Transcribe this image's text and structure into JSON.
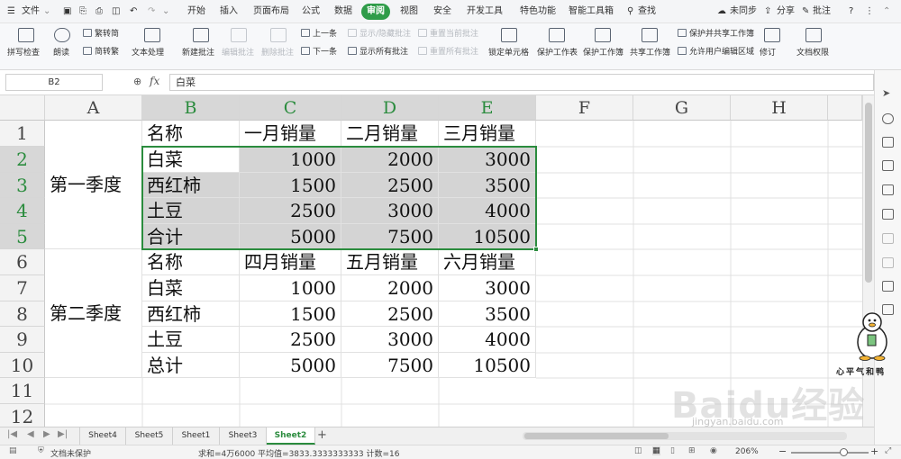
{
  "menubar": {
    "file": "文件",
    "menus": [
      "开始",
      "插入",
      "页面布局",
      "公式",
      "数据",
      "审阅",
      "视图",
      "安全",
      "开发工具",
      "特色功能",
      "智能工具箱"
    ],
    "search": "查找",
    "sync": "未同步",
    "share": "分享",
    "comment": "批注",
    "help": "?"
  },
  "ribbon": {
    "spell_check": "拼写检查",
    "read_aloud": "朗读",
    "trad_to_simp": "繁转简",
    "simp_to_trad": "简转繁",
    "text_process": "文本处理",
    "new_comment": "新建批注",
    "edit_comment": "编辑批注",
    "delete_comment": "删除批注",
    "prev": "上一条",
    "next": "下一条",
    "show_hide_comment": "显示/隐藏批注",
    "show_all_comments": "显示所有批注",
    "reset_current_comment": "重置当前批注",
    "reset_all_comments": "重置所有批注",
    "lock_cell": "锁定单元格",
    "protect_sheet": "保护工作表",
    "protect_workbook": "保护工作簿",
    "share_workbook": "共享工作簿",
    "protect_share_workbook": "保护并共享工作簿",
    "allow_edit_range": "允许用户编辑区域",
    "revise": "修订",
    "doc_permission": "文档权限"
  },
  "formula_bar": {
    "name_box": "B2",
    "fx": "fx",
    "content": "白菜"
  },
  "columns": [
    "A",
    "B",
    "C",
    "D",
    "E",
    "F",
    "G",
    "H"
  ],
  "rows": [
    "1",
    "2",
    "3",
    "4",
    "5",
    "6",
    "7",
    "8",
    "9",
    "10",
    "11",
    "12"
  ],
  "cells": {
    "A_q1": "第一季度",
    "A_q2": "第二季度",
    "r1": [
      "名称",
      "一月销量",
      "二月销量",
      "三月销量"
    ],
    "r2": [
      "白菜",
      "1000",
      "2000",
      "3000"
    ],
    "r3": [
      "西红柿",
      "1500",
      "2500",
      "3500"
    ],
    "r4": [
      "土豆",
      "2500",
      "3000",
      "4000"
    ],
    "r5": [
      "合计",
      "5000",
      "7500",
      "10500"
    ],
    "r6": [
      "名称",
      "四月销量",
      "五月销量",
      "六月销量"
    ],
    "r7": [
      "白菜",
      "1000",
      "2000",
      "3000"
    ],
    "r8": [
      "西红柿",
      "1500",
      "2500",
      "3500"
    ],
    "r9": [
      "土豆",
      "2500",
      "3000",
      "4000"
    ],
    "r10": [
      "总计",
      "5000",
      "7500",
      "10500"
    ]
  },
  "sheet_tabs": [
    "Sheet4",
    "Sheet5",
    "Sheet1",
    "Sheet3",
    "Sheet2"
  ],
  "active_sheet": "Sheet2",
  "add_sheet": "+",
  "status": {
    "protect": "文档未保护",
    "stats": "求和=4万6000  平均值=3833.3333333333  计数=16",
    "zoom": "206%",
    "zoom_minus": "−",
    "zoom_plus": "+"
  },
  "watermark": {
    "main": "Baidu经验",
    "sub": "jingyan.baidu.com"
  },
  "mascot_text": "心平气和鸭",
  "colors": {
    "accent": "#2f9c49",
    "selection_border": "#2b8c3e",
    "selection_fill": "#d4d4d4"
  }
}
